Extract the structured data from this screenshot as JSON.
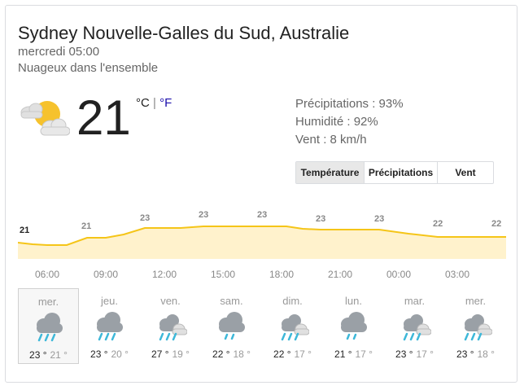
{
  "location": "Sydney Nouvelle-Galles du Sud, Australie",
  "datetime": "mercredi 05:00",
  "condition": "Nuageux dans l'ensemble",
  "current": {
    "temp": "21",
    "unit_c": "°C",
    "unit_sep": " | ",
    "unit_f": "°F",
    "icon": "partly-cloudy-icon"
  },
  "details": {
    "precipitation": "Précipitations : 93%",
    "humidity": "Humidité : 92%",
    "wind": "Vent : 8 km/h"
  },
  "tabs": [
    {
      "label": "Température",
      "active": true
    },
    {
      "label": "Précipitations",
      "active": false
    },
    {
      "label": "Vent",
      "active": false
    }
  ],
  "hourly": {
    "labels": [
      "06:00",
      "09:00",
      "12:00",
      "15:00",
      "18:00",
      "21:00",
      "00:00",
      "03:00"
    ],
    "points": [
      21,
      21,
      23,
      23,
      23,
      23,
      23,
      22,
      22
    ],
    "point_labels": [
      "21",
      "21",
      "23",
      "23",
      "23",
      "23",
      "23",
      "22",
      "22"
    ],
    "fill_color": "#fff2cc",
    "line_color": "#f5c518"
  },
  "daily": [
    {
      "day": "mer.",
      "hi": "23 °",
      "lo": "21 °",
      "icon": "rain-icon"
    },
    {
      "day": "jeu.",
      "hi": "23 °",
      "lo": "20 °",
      "icon": "rain-icon"
    },
    {
      "day": "ven.",
      "hi": "27 °",
      "lo": "19 °",
      "icon": "showers-icon"
    },
    {
      "day": "sam.",
      "hi": "22 °",
      "lo": "18 °",
      "icon": "light-rain-icon"
    },
    {
      "day": "dim.",
      "hi": "22 °",
      "lo": "17 °",
      "icon": "showers-icon"
    },
    {
      "day": "lun.",
      "hi": "21 °",
      "lo": "17 °",
      "icon": "light-rain-icon"
    },
    {
      "day": "mar.",
      "hi": "23 °",
      "lo": "17 °",
      "icon": "showers-icon"
    },
    {
      "day": "mer.",
      "hi": "23 °",
      "lo": "18 °",
      "icon": "showers-icon"
    }
  ]
}
